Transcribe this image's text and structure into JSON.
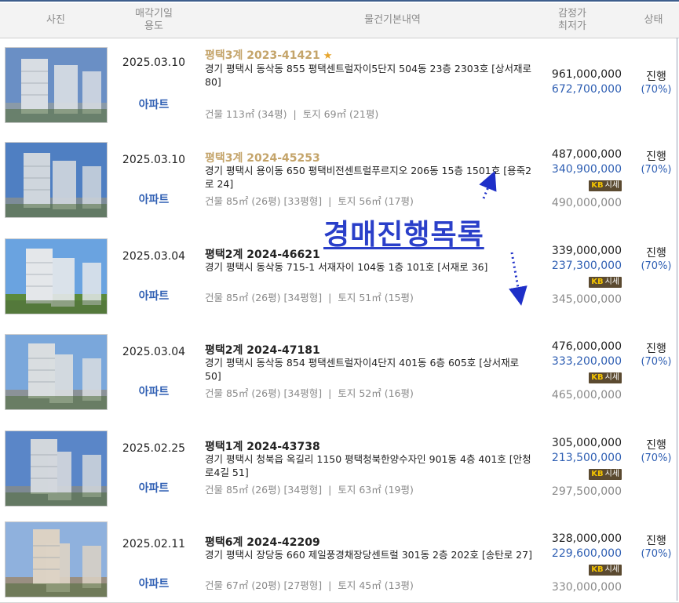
{
  "header": {
    "photo": "사진",
    "date_use": "매각기일\n용도",
    "info": "물건기본내역",
    "price": "감정가\n최저가",
    "status": "상태"
  },
  "overlay": {
    "text": "경매진행목록"
  },
  "colors": {
    "accent_blue": "#2f5fb3",
    "gold_case": "#c4a46a",
    "overlay_blue": "#2a3fc9"
  },
  "rows": [
    {
      "date": "2025.03.10",
      "use": "아파트",
      "case": "평택3계 2023-41421",
      "case_style": "gold",
      "starred": true,
      "address": "경기 평택시 동삭동 855 평택센트럴자이5단지 504동 23층 2303호 [상서재로 80]",
      "area_building": "건물 113㎡ (34평)",
      "area_land": "토지 69㎡ (21평)",
      "appraise": "961,000,000",
      "min_price": "672,700,000",
      "has_sise": false,
      "market": "",
      "status": "진행",
      "percent": "(70%)"
    },
    {
      "date": "2025.03.10",
      "use": "아파트",
      "case": "평택3계 2024-45253",
      "case_style": "gold",
      "starred": false,
      "address": "경기 평택시 용이동 650 평택비전센트럴푸르지오 206동 15층 1501호 [용죽2로 24]",
      "area_building": "건물 85㎡ (26평) [33평형]",
      "area_land": "토지 56㎡ (17평)",
      "appraise": "487,000,000",
      "min_price": "340,900,000",
      "has_sise": true,
      "market": "490,000,000",
      "status": "진행",
      "percent": "(70%)"
    },
    {
      "date": "2025.03.04",
      "use": "아파트",
      "case": "평택2계 2024-46621",
      "case_style": "black",
      "starred": false,
      "address": "경기 평택시 동삭동 715-1 서재자이 104동 1층 101호 [서재로 36]",
      "area_building": "건물 85㎡ (26평) [34평형]",
      "area_land": "토지 51㎡ (15평)",
      "appraise": "339,000,000",
      "min_price": "237,300,000",
      "has_sise": true,
      "market": "345,000,000",
      "status": "진행",
      "percent": "(70%)"
    },
    {
      "date": "2025.03.04",
      "use": "아파트",
      "case": "평택2계 2024-47181",
      "case_style": "black",
      "starred": false,
      "address": "경기 평택시 동삭동 854 평택센트럴자이4단지 401동 6층 605호 [상서재로 50]",
      "area_building": "건물 85㎡ (26평) [34평형]",
      "area_land": "토지 52㎡ (16평)",
      "appraise": "476,000,000",
      "min_price": "333,200,000",
      "has_sise": true,
      "market": "465,000,000",
      "status": "진행",
      "percent": "(70%)"
    },
    {
      "date": "2025.02.25",
      "use": "아파트",
      "case": "평택1계 2024-43738",
      "case_style": "black",
      "starred": false,
      "address": "경기 평택시 청북읍 옥길리 1150 평택청북한양수자인 901동 4층 401호 [안청로4길 51]",
      "area_building": "건물 85㎡ (26평) [34평형]",
      "area_land": "토지 63㎡ (19평)",
      "appraise": "305,000,000",
      "min_price": "213,500,000",
      "has_sise": true,
      "market": "297,500,000",
      "status": "진행",
      "percent": "(70%)"
    },
    {
      "date": "2025.02.11",
      "use": "아파트",
      "case": "평택6계 2024-42209",
      "case_style": "black",
      "starred": false,
      "address": "경기 평택시 장당동 660 제일풍경채장당센트럴 301동 2층 202호 [송탄로 27]",
      "area_building": "건물 67㎡ (20평) [27평형]",
      "area_land": "토지 45㎡ (13평)",
      "appraise": "328,000,000",
      "min_price": "229,600,000",
      "has_sise": true,
      "market": "330,000,000",
      "status": "진행",
      "percent": "(70%)"
    }
  ],
  "sise_label": "시세"
}
